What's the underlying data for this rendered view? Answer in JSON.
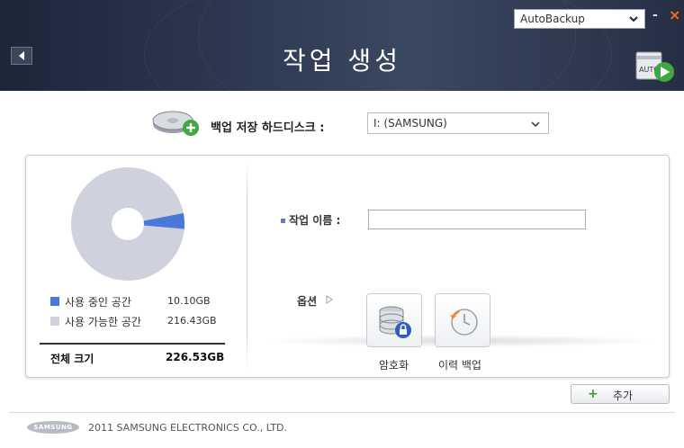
{
  "header": {
    "title": "작업 생성",
    "backup_mode_select": "AutoBackup",
    "minimize": "-",
    "close": "×",
    "auto_icon_text": "AUTO"
  },
  "disk": {
    "label": "백업 저장 하드디스크 :",
    "selected": "I: (SAMSUNG)"
  },
  "usage": {
    "used_fraction": 0.0446,
    "used_label": "사용 중인 공간",
    "used_value": "10.10GB",
    "free_label": "사용 가능한 공간",
    "free_value": "216.43GB",
    "total_label": "전체 크기",
    "total_value": "226.53GB",
    "colors": {
      "used": "#4a78d8",
      "free": "#cfd1dc"
    }
  },
  "job": {
    "name_label": "작업 이름 :",
    "name_value": ""
  },
  "options": {
    "label": "옵션",
    "encrypt_label": "암호화",
    "history_label": "이력 백업"
  },
  "actions": {
    "add_plus": "+",
    "add_label": "추가"
  },
  "footer": {
    "logo": "SAMSUNG",
    "copyright": "2011 SAMSUNG ELECTRONICS CO., LTD."
  }
}
